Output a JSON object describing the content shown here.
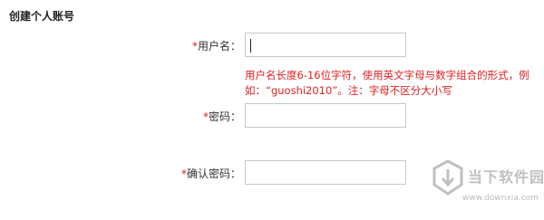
{
  "form": {
    "title": "创建个人账号",
    "required_mark": "*",
    "username": {
      "label": "用户名：",
      "value": "",
      "hint": "用户名长度6-16位字符，使用英文字母与数字组合的形式，例如：“guoshi2010”。注：字母不区分大小写"
    },
    "password": {
      "label": "密码：",
      "value": ""
    },
    "confirm_password": {
      "label": "确认密码：",
      "value": ""
    }
  },
  "watermark": {
    "logo_icon": "downxia-logo-icon",
    "text": "当下软件园",
    "url": "www.downxia.com"
  }
}
